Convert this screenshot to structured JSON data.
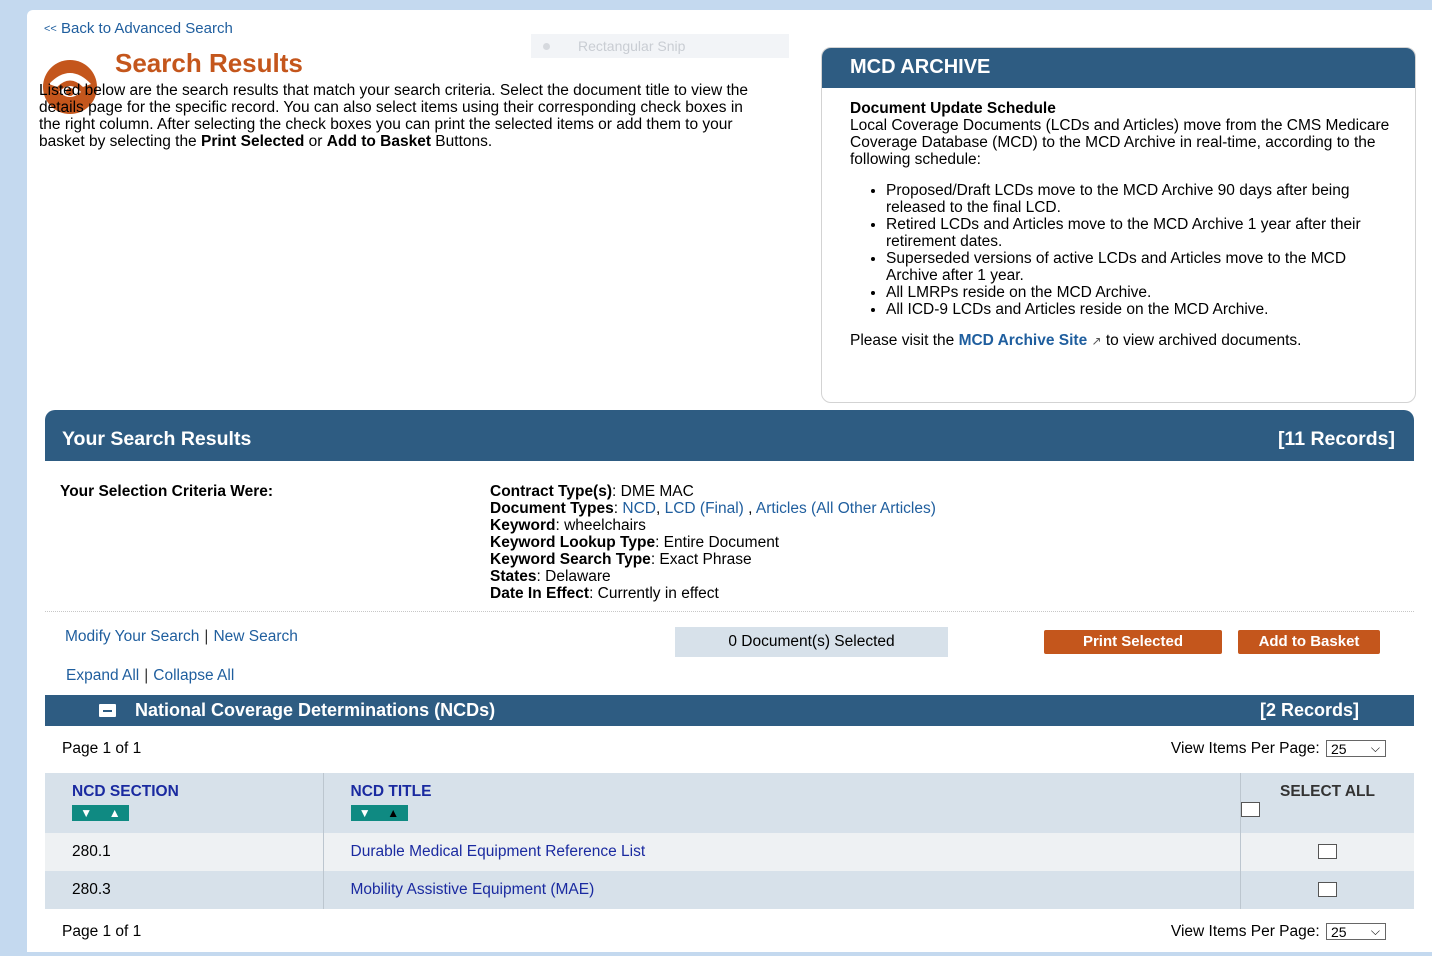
{
  "back_link": "Back to Advanced Search",
  "back_chev": "<<",
  "snip_overlay": "Rectangular Snip",
  "page_title": "Search Results",
  "intro": {
    "t1": "Listed below are the search results that match your search criteria. Select the document title to view the details page for the specific record. You can also select items using their corresponding check boxes in the right column. After selecting the check boxes you can print the selected items or add them to your basket by selecting the ",
    "b1": "Print Selected",
    "t2": " or ",
    "b2": "Add to Basket",
    "t3": " Buttons."
  },
  "archive": {
    "header": "MCD ARCHIVE",
    "schedule_title": "Document Update Schedule",
    "schedule_text": "Local Coverage Documents (LCDs and Articles) move from the CMS Medicare Coverage Database (MCD) to the MCD Archive in real-time, according to the following schedule:",
    "bullets": [
      "Proposed/Draft LCDs move to the MCD Archive 90 days after being released to the final LCD.",
      "Retired LCDs and Articles move to the MCD Archive 1 year after their retirement dates.",
      "Superseded versions of active LCDs and Articles move to the MCD Archive after 1 year.",
      "All LMRPs reside on the MCD Archive.",
      "All ICD-9 LCDs and Articles reside on the MCD Archive."
    ],
    "visit_pre": "Please visit the ",
    "visit_link": "MCD Archive Site",
    "visit_post": " to view archived documents."
  },
  "results": {
    "header": "Your Search Results",
    "count": "[11 Records]",
    "criteria_label": "Your Selection Criteria Were:",
    "criteria": {
      "contract_label": "Contract Type(s)",
      "contract_value": ": DME MAC",
      "doctypes_label": "Document Types",
      "doctypes_ncd": "NCD",
      "doctypes_lcd": "LCD (Final)",
      "doctypes_articles": "Articles (All Other Articles)",
      "keyword_label": "Keyword",
      "keyword_value": ": wheelchairs",
      "lookup_label": "Keyword Lookup Type",
      "lookup_value": ": Entire Document",
      "search_type_label": "Keyword Search Type",
      "search_type_value": ": Exact Phrase",
      "states_label": "States",
      "states_value": ": Delaware",
      "date_label": "Date In Effect",
      "date_value": ": Currently in effect"
    },
    "modify_search": "Modify Your Search",
    "new_search": "New Search",
    "expand_all": "Expand All",
    "collapse_all": "Collapse All",
    "selected_count": "0 Document(s) Selected",
    "print_selected": "Print Selected",
    "add_to_basket": "Add to Basket"
  },
  "ncd_section": {
    "title": "National Coverage Determinations (NCDs)",
    "count": "[2 Records]",
    "page_info": "Page 1 of 1",
    "per_page_label": "View Items Per Page:",
    "per_page_value": "25",
    "col_section": "NCD SECTION",
    "col_title": "NCD TITLE",
    "col_select": "SELECT ALL",
    "rows": [
      {
        "section": "280.1",
        "title": "Durable Medical Equipment Reference List"
      },
      {
        "section": "280.3",
        "title": "Mobility Assistive Equipment (MAE)"
      }
    ],
    "page_info_bottom": "Page 1 of 1",
    "per_page_label_bottom": "View Items Per Page:",
    "per_page_value_bottom": "25"
  },
  "colors": {
    "accent_orange": "#c4561c",
    "header_blue": "#2e5c82",
    "link_blue": "#1f5e9e",
    "row_blue": "#d7e1ea",
    "sort_teal": "#0f8a82"
  }
}
